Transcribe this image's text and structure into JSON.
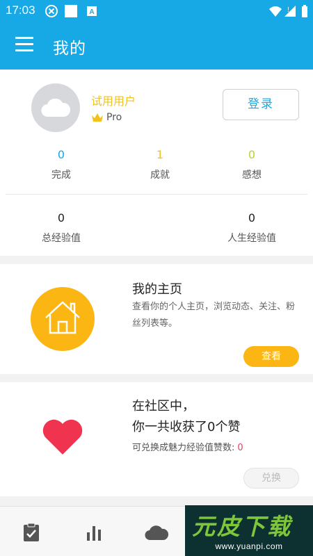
{
  "statusbar": {
    "time": "17:03",
    "icons": [
      "close-circle-icon",
      "square-icon",
      "a-icon",
      "wifi-icon",
      "signal-icon",
      "battery-icon"
    ]
  },
  "appbar": {
    "title": "我的",
    "menu_icon": "menu-icon"
  },
  "profile": {
    "username": "试用用户",
    "badge": "Pro",
    "login_label": "登录",
    "stats": [
      {
        "value": "0",
        "label": "完成",
        "color": "#16a9e6"
      },
      {
        "value": "1",
        "label": "成就",
        "color": "#f2c21b"
      },
      {
        "value": "0",
        "label": "感想",
        "color": "#b7d433"
      }
    ],
    "exp": [
      {
        "value": "0",
        "label": "总经验值"
      },
      {
        "value": "0",
        "label": "人生经验值"
      }
    ]
  },
  "homepage": {
    "title": "我的主页",
    "desc": "查看你的个人主页，浏览动态、关注、粉丝列表等。",
    "button": "查看"
  },
  "likes": {
    "line1": "在社区中，",
    "line2": "你一共收获了0个赞",
    "desc": "可兑换成魅力经验值赞数:",
    "count": "0",
    "button": "兑换"
  },
  "bottomnav": {
    "items": [
      "clipboard-check-icon",
      "bar-chart-icon",
      "cloud-icon"
    ]
  },
  "watermark": {
    "text": "元皮下载",
    "url": "www.yuanpi.com"
  },
  "colors": {
    "primary": "#16a9e6",
    "accent": "#fbb613",
    "heart": "#f0334f",
    "gold": "#f2c21b"
  }
}
